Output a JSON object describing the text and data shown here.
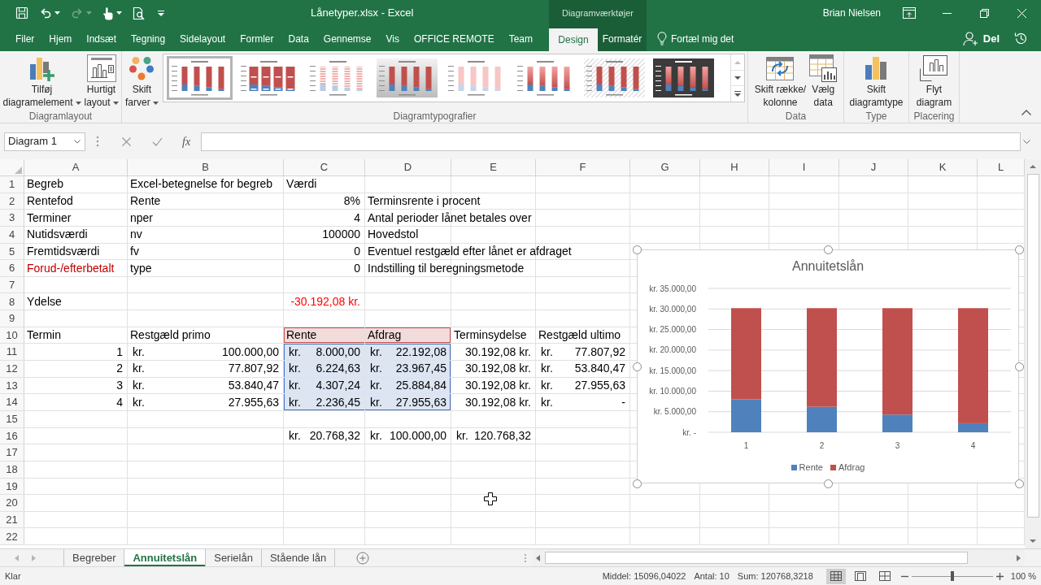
{
  "window": {
    "title": "Lånetyper.xlsx - Excel",
    "context_group": "Diagramværktøjer",
    "user": "Brian Nielsen"
  },
  "quick_access": [
    {
      "kind": "save",
      "disabled": false,
      "dropdown": false
    },
    {
      "kind": "undo",
      "disabled": false,
      "dropdown": true
    },
    {
      "kind": "redo",
      "disabled": true,
      "dropdown": true
    },
    {
      "kind": "touch",
      "disabled": false,
      "dropdown": true
    },
    {
      "kind": "preview",
      "disabled": false,
      "dropdown": false
    }
  ],
  "ribbon_tabs": [
    {
      "label": "Filer",
      "selected": false,
      "kind": "standard"
    },
    {
      "label": "Hjem",
      "selected": false,
      "kind": "standard"
    },
    {
      "label": "Indsæt",
      "selected": false,
      "kind": "standard"
    },
    {
      "label": "Tegning",
      "selected": false,
      "kind": "standard"
    },
    {
      "label": "Sidelayout",
      "selected": false,
      "kind": "standard"
    },
    {
      "label": "Formler",
      "selected": false,
      "kind": "standard"
    },
    {
      "label": "Data",
      "selected": false,
      "kind": "standard"
    },
    {
      "label": "Gennemse",
      "selected": false,
      "kind": "standard"
    },
    {
      "label": "Vis",
      "selected": false,
      "kind": "standard"
    },
    {
      "label": "OFFICE REMOTE",
      "selected": false,
      "kind": "standard"
    },
    {
      "label": "Team",
      "selected": false,
      "kind": "standard"
    },
    {
      "label": "Design",
      "selected": true,
      "kind": "contextual"
    },
    {
      "label": "Formatér",
      "selected": false,
      "kind": "contextual"
    }
  ],
  "tell_me": {
    "label": "Fortæl mig det"
  },
  "share": {
    "label": "Del"
  },
  "ribbon": {
    "groups": [
      {
        "label": "Diagramlayout",
        "buttons": [
          {
            "label": "Tilføj\ndiagramelement",
            "dropdown": true
          },
          {
            "label": "Hurtigt\nlayout",
            "dropdown": true
          }
        ]
      },
      {
        "label": "Diagramtypografier",
        "buttons": [
          {
            "label": "Skift\nfarver",
            "dropdown": true
          }
        ],
        "gallery": [
          {
            "kind": "plain",
            "selected": true
          },
          {
            "kind": "labels",
            "selected": false
          },
          {
            "kind": "striped",
            "selected": false
          },
          {
            "kind": "shaded",
            "selected": false
          },
          {
            "kind": "pale",
            "selected": false
          },
          {
            "kind": "gradient",
            "selected": false
          },
          {
            "kind": "hatched",
            "selected": false
          },
          {
            "kind": "dark",
            "selected": false
          }
        ]
      },
      {
        "label": "Data",
        "buttons": [
          {
            "label": "Skift række/\nkolonne",
            "dropdown": false
          },
          {
            "label": "Vælg\ndata",
            "dropdown": false
          }
        ]
      },
      {
        "label": "Type",
        "buttons": [
          {
            "label": "Skift\ndiagramtype",
            "dropdown": false
          }
        ]
      },
      {
        "label": "Placering",
        "buttons": [
          {
            "label": "Flyt\ndiagram",
            "dropdown": false
          }
        ]
      }
    ]
  },
  "formula_bar": {
    "name_box": {
      "value": "Diagram 1"
    },
    "function_label": "fx"
  },
  "sheet": {
    "columns": [
      "A",
      "B",
      "C",
      "D",
      "E",
      "F",
      "G",
      "H",
      "I",
      "J",
      "K",
      "L"
    ],
    "rows": [
      {
        "header": "1",
        "cells": [
          {
            "kind": "text",
            "text": "Begreb"
          },
          {
            "kind": "text",
            "text": "Excel-betegnelse for begreb"
          },
          {
            "kind": "text",
            "text": "Værdi"
          }
        ]
      },
      {
        "header": "2",
        "cells": [
          {
            "kind": "text",
            "text": "Rentefod"
          },
          {
            "kind": "text",
            "text": "Rente"
          },
          {
            "kind": "number",
            "text": "8%"
          },
          {
            "kind": "text",
            "text": "Terminsrente i procent"
          }
        ]
      },
      {
        "header": "3",
        "cells": [
          {
            "kind": "text",
            "text": "Terminer"
          },
          {
            "kind": "text",
            "text": "nper"
          },
          {
            "kind": "number",
            "text": "4"
          },
          {
            "kind": "text",
            "text": "Antal perioder lånet betales over"
          }
        ]
      },
      {
        "header": "4",
        "cells": [
          {
            "kind": "text",
            "text": "Nutidsværdi"
          },
          {
            "kind": "text",
            "text": "nv"
          },
          {
            "kind": "number",
            "text": "100000"
          },
          {
            "kind": "text",
            "text": "Hovedstol"
          }
        ]
      },
      {
        "header": "5",
        "cells": [
          {
            "kind": "text",
            "text": "Fremtidsværdi"
          },
          {
            "kind": "text",
            "text": "fv"
          },
          {
            "kind": "number",
            "text": "0"
          },
          {
            "kind": "text",
            "text": "Eventuel restgæld efter lånet er afdraget"
          }
        ]
      },
      {
        "header": "6",
        "cells": [
          {
            "kind": "text",
            "text": "Forud-/efterbetalt",
            "color": "#c00000"
          },
          {
            "kind": "text",
            "text": "type"
          },
          {
            "kind": "number",
            "text": "0"
          },
          {
            "kind": "text",
            "text": "Indstilling til beregningsmetode"
          }
        ]
      },
      {
        "header": "7"
      },
      {
        "header": "8",
        "cells": [
          {
            "kind": "text",
            "text": "Ydelse"
          },
          null,
          {
            "kind": "number",
            "text": "-30.192,08 kr.",
            "color": "#ff0000"
          }
        ]
      },
      {
        "header": "9"
      },
      {
        "header": "10",
        "cells": [
          {
            "kind": "text",
            "text": "Termin"
          },
          {
            "kind": "text",
            "text": "Restgæld primo"
          },
          {
            "kind": "text",
            "text": "Rente",
            "series_name_range": true
          },
          {
            "kind": "text",
            "text": "Afdrag",
            "series_name_range": true
          },
          {
            "kind": "text",
            "text": "Terminsydelse"
          },
          {
            "kind": "text",
            "text": "Restgæld ultimo"
          }
        ]
      },
      {
        "header": "11",
        "cells": [
          {
            "kind": "number",
            "text": "1"
          },
          {
            "kind": "accounting",
            "currency": "kr.",
            "amount": "100.000,00"
          },
          {
            "kind": "accounting",
            "currency": "kr.",
            "amount": "8.000,00",
            "series_values_range": true
          },
          {
            "kind": "accounting",
            "currency": "kr.",
            "amount": "22.192,08",
            "series_values_range": true
          },
          {
            "kind": "number",
            "text": "30.192,08 kr."
          },
          {
            "kind": "accounting",
            "currency": "kr.",
            "amount": "77.807,92"
          }
        ]
      },
      {
        "header": "12",
        "cells": [
          {
            "kind": "number",
            "text": "2"
          },
          {
            "kind": "accounting",
            "currency": "kr.",
            "amount": "77.807,92"
          },
          {
            "kind": "accounting",
            "currency": "kr.",
            "amount": "6.224,63",
            "series_values_range": true
          },
          {
            "kind": "accounting",
            "currency": "kr.",
            "amount": "23.967,45",
            "series_values_range": true
          },
          {
            "kind": "number",
            "text": "30.192,08 kr."
          },
          {
            "kind": "accounting",
            "currency": "kr.",
            "amount": "53.840,47"
          }
        ]
      },
      {
        "header": "13",
        "cells": [
          {
            "kind": "number",
            "text": "3"
          },
          {
            "kind": "accounting",
            "currency": "kr.",
            "amount": "53.840,47"
          },
          {
            "kind": "accounting",
            "currency": "kr.",
            "amount": "4.307,24",
            "series_values_range": true
          },
          {
            "kind": "accounting",
            "currency": "kr.",
            "amount": "25.884,84",
            "series_values_range": true
          },
          {
            "kind": "number",
            "text": "30.192,08 kr."
          },
          {
            "kind": "accounting",
            "currency": "kr.",
            "amount": "27.955,63"
          }
        ]
      },
      {
        "header": "14",
        "cells": [
          {
            "kind": "number",
            "text": "4"
          },
          {
            "kind": "accounting",
            "currency": "kr.",
            "amount": "27.955,63"
          },
          {
            "kind": "accounting",
            "currency": "kr.",
            "amount": "2.236,45",
            "series_values_range": true
          },
          {
            "kind": "accounting",
            "currency": "kr.",
            "amount": "27.955,63",
            "series_values_range": true
          },
          {
            "kind": "number",
            "text": "30.192,08 kr."
          },
          {
            "kind": "accounting",
            "currency": "kr.",
            "amount": "-"
          }
        ]
      },
      {
        "header": "15"
      },
      {
        "header": "16",
        "cells": [
          null,
          null,
          {
            "kind": "accounting",
            "currency": "kr.",
            "amount": "20.768,32"
          },
          {
            "kind": "accounting",
            "currency": "kr.",
            "amount": "100.000,00"
          },
          {
            "kind": "accounting",
            "currency": "kr.",
            "amount": "120.768,32"
          }
        ]
      },
      {
        "header": "17"
      },
      {
        "header": "18"
      },
      {
        "header": "19"
      },
      {
        "header": "20"
      },
      {
        "header": "21"
      },
      {
        "header": "22"
      }
    ]
  },
  "chart": {
    "selected": true,
    "chart_data": {
      "type": "bar",
      "title": "Annuitetslån",
      "categories": [
        "1",
        "2",
        "3",
        "4"
      ],
      "series": [
        {
          "name": "Rente",
          "color": "#4f81bd",
          "values": [
            8000,
            6200,
            4300,
            2200
          ]
        },
        {
          "name": "Afdrag",
          "color": "#c0504d",
          "values": [
            22200,
            24000,
            25900,
            28000
          ]
        }
      ],
      "stacked": true,
      "orientation": "vertical",
      "grid": true,
      "legend": "bottom",
      "ylim": [
        0,
        35000
      ],
      "yticks": [
        {
          "value": 0,
          "label": "kr. -"
        },
        {
          "value": 5000,
          "label": "kr. 5.000,00"
        },
        {
          "value": 10000,
          "label": "kr. 10.000,00"
        },
        {
          "value": 15000,
          "label": "kr. 15.000,00"
        },
        {
          "value": 20000,
          "label": "kr. 20.000,00"
        },
        {
          "value": 25000,
          "label": "kr. 25.000,00"
        },
        {
          "value": 30000,
          "label": "kr. 30.000,00"
        },
        {
          "value": 35000,
          "label": "kr. 35.000,00"
        }
      ]
    }
  },
  "sheet_tabs": [
    {
      "label": "Begreber",
      "selected": false
    },
    {
      "label": "Annuitetslån",
      "selected": true
    },
    {
      "label": "Serielån",
      "selected": false
    },
    {
      "label": "Stående lån",
      "selected": false
    }
  ],
  "status_bar": {
    "mode": "Klar",
    "stats": [
      "Middel: 15096,04022",
      "Antal: 10",
      "Sum: 120768,3218"
    ],
    "views": [
      {
        "selected": true
      },
      {
        "selected": false
      },
      {
        "selected": false
      }
    ],
    "zoom": {
      "level": 0.5,
      "reading": "100 %"
    }
  }
}
